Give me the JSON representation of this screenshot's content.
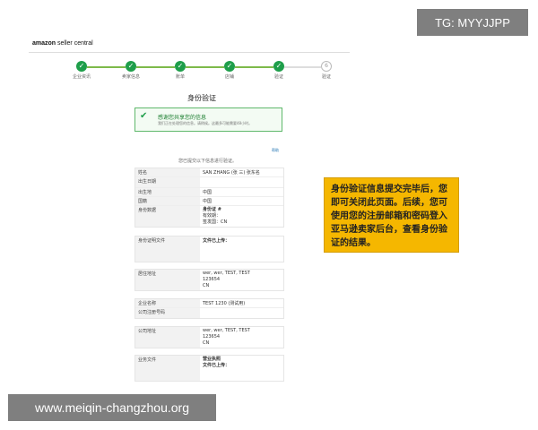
{
  "overlay": {
    "tg_badge": "TG: MYYJJPP",
    "site_badge": "www.meiqin-changzhou.org"
  },
  "header": {
    "logo_amazon": "amazon",
    "logo_product": "seller central"
  },
  "stepper": {
    "steps": [
      {
        "label": "企业资讯",
        "done": true,
        "icon": "check-icon"
      },
      {
        "label": "卖家信息",
        "done": true,
        "icon": "check-icon"
      },
      {
        "label": "账单",
        "done": true,
        "icon": "check-icon"
      },
      {
        "label": "店铺",
        "done": true,
        "icon": "check-icon"
      },
      {
        "label": "验证",
        "done": true,
        "icon": "check-icon"
      },
      {
        "label": "验证",
        "done": false,
        "number": "6"
      }
    ],
    "accent_color": "#1e9e4a"
  },
  "page_title": "身份验证",
  "success": {
    "title": "感谢您共享您的信息",
    "subtitle": "我们正在处理您的信息。请稍候。这最多可能需要48小时。"
  },
  "help_link": "帮助",
  "review_note": "您已提交以下信息进行验证。",
  "sections": {
    "personal": [
      {
        "label": "姓名",
        "value": "SAN ZHANG (张 三) 张东名"
      },
      {
        "label": "出生日期",
        "value": ""
      },
      {
        "label": "出生地",
        "value": "中国"
      },
      {
        "label": "国籍",
        "value": "中国"
      },
      {
        "label": "身份数据",
        "lines": [
          "身份证 #",
          "有效期：",
          "签发国：CN"
        ]
      }
    ],
    "id_docs": {
      "label": "身份证明文件",
      "value": "文件已上传："
    },
    "residence": {
      "label": "居住地址",
      "lines": [
        "wer, wer, TEST, TEST",
        "123654",
        "CN"
      ]
    },
    "company": [
      {
        "label": "企业名称",
        "value": "TEST 1230 (测试用)"
      },
      {
        "label": "公司注册号码",
        "value": ""
      }
    ],
    "company_address": {
      "label": "公司地址",
      "lines": [
        "wer, wer, TEST, TEST",
        "123654",
        "CN"
      ]
    },
    "business_docs": {
      "label": "业务文件",
      "lines": [
        "营业执照",
        "文件已上传："
      ]
    }
  },
  "callout": {
    "text": "身份验证信息提交完毕后，您即可关闭此页面。后续，您可使用您的注册邮箱和密码登入亚马逊卖家后台，查看身份验证的结果。"
  }
}
